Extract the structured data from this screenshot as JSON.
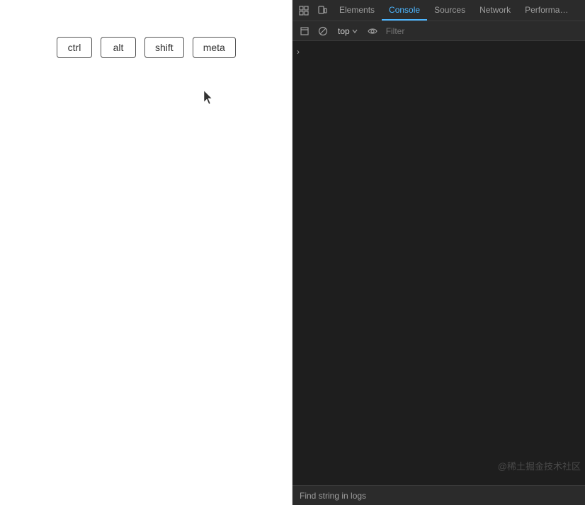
{
  "mainPage": {
    "background": "#ffffff"
  },
  "keyButtons": {
    "buttons": [
      {
        "id": "ctrl",
        "label": "ctrl"
      },
      {
        "id": "alt",
        "label": "alt"
      },
      {
        "id": "shift",
        "label": "shift"
      },
      {
        "id": "meta",
        "label": "meta"
      }
    ]
  },
  "devtools": {
    "tabs": [
      {
        "id": "elements",
        "label": "Elements",
        "active": false
      },
      {
        "id": "console",
        "label": "Console",
        "active": true
      },
      {
        "id": "sources",
        "label": "Sources",
        "active": false
      },
      {
        "id": "network",
        "label": "Network",
        "active": false
      },
      {
        "id": "performance",
        "label": "Performa…",
        "active": false
      }
    ],
    "toolbar": {
      "contextSelector": "top",
      "filterPlaceholder": "Filter"
    },
    "console": {
      "expandArrow": "›"
    },
    "watermark": "@稀土掘金技术社区",
    "findBar": {
      "text": "Find string in logs"
    }
  }
}
